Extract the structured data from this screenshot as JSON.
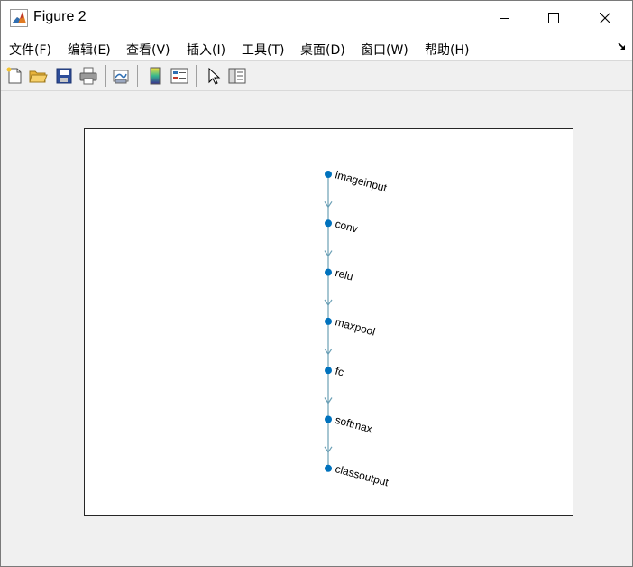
{
  "window": {
    "title": "Figure 2",
    "icon": "matlab-icon"
  },
  "menubar": {
    "items": [
      {
        "label": "文件(F)",
        "id": "file"
      },
      {
        "label": "编辑(E)",
        "id": "edit"
      },
      {
        "label": "查看(V)",
        "id": "view"
      },
      {
        "label": "插入(I)",
        "id": "insert"
      },
      {
        "label": "工具(T)",
        "id": "tools"
      },
      {
        "label": "桌面(D)",
        "id": "desktop"
      },
      {
        "label": "窗口(W)",
        "id": "window"
      },
      {
        "label": "帮助(H)",
        "id": "help"
      }
    ]
  },
  "toolbar": {
    "buttons": [
      "new-figure-icon",
      "open-file-icon",
      "save-icon",
      "print-icon",
      "link-plot-icon",
      "colorbar-icon",
      "legend-icon",
      "pointer-icon",
      "property-editor-icon"
    ]
  },
  "chart_data": {
    "type": "diagram",
    "layout": "layered",
    "nodes": [
      "imageinput",
      "conv",
      "relu",
      "maxpool",
      "fc",
      "softmax",
      "classoutput"
    ],
    "edges": [
      [
        "imageinput",
        "conv"
      ],
      [
        "conv",
        "relu"
      ],
      [
        "relu",
        "maxpool"
      ],
      [
        "maxpool",
        "fc"
      ],
      [
        "fc",
        "softmax"
      ],
      [
        "softmax",
        "classoutput"
      ]
    ],
    "node_color": "#0072bd",
    "edge_color": "#6a9fb5"
  }
}
